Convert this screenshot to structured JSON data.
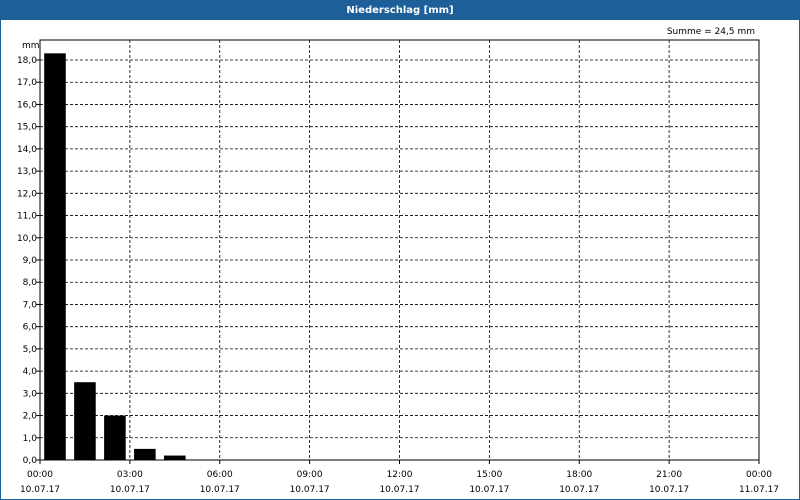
{
  "window": {
    "title": "Niederschlag [mm]"
  },
  "chart_data": {
    "type": "bar",
    "title": "Niederschlag [mm]",
    "ylabel": "mm",
    "annotation": "Summe = 24,5 mm",
    "ylim": [
      0,
      18.9
    ],
    "y_ticks": [
      "0,0",
      "1,0",
      "2,0",
      "3,0",
      "4,0",
      "5,0",
      "6,0",
      "7,0",
      "8,0",
      "9,0",
      "10,0",
      "11,0",
      "12,0",
      "13,0",
      "14,0",
      "15,0",
      "16,0",
      "17,0",
      "18,0"
    ],
    "x_ticks": [
      {
        "time": "00:00",
        "date": "10.07.17"
      },
      {
        "time": "03:00",
        "date": "10.07.17"
      },
      {
        "time": "06:00",
        "date": "10.07.17"
      },
      {
        "time": "09:00",
        "date": "10.07.17"
      },
      {
        "time": "12:00",
        "date": "10.07.17"
      },
      {
        "time": "15:00",
        "date": "10.07.17"
      },
      {
        "time": "18:00",
        "date": "10.07.17"
      },
      {
        "time": "21:00",
        "date": "10.07.17"
      },
      {
        "time": "00:00",
        "date": "11.07.17"
      }
    ],
    "x_range_hours": [
      0,
      24
    ],
    "bars": [
      {
        "hour": 0,
        "value": 18.3
      },
      {
        "hour": 1,
        "value": 3.5
      },
      {
        "hour": 2,
        "value": 2.0
      },
      {
        "hour": 3,
        "value": 0.5
      },
      {
        "hour": 4,
        "value": 0.2
      }
    ],
    "grid": true,
    "bar_color": "#000000",
    "title_bar_color": "#1f5f99"
  }
}
